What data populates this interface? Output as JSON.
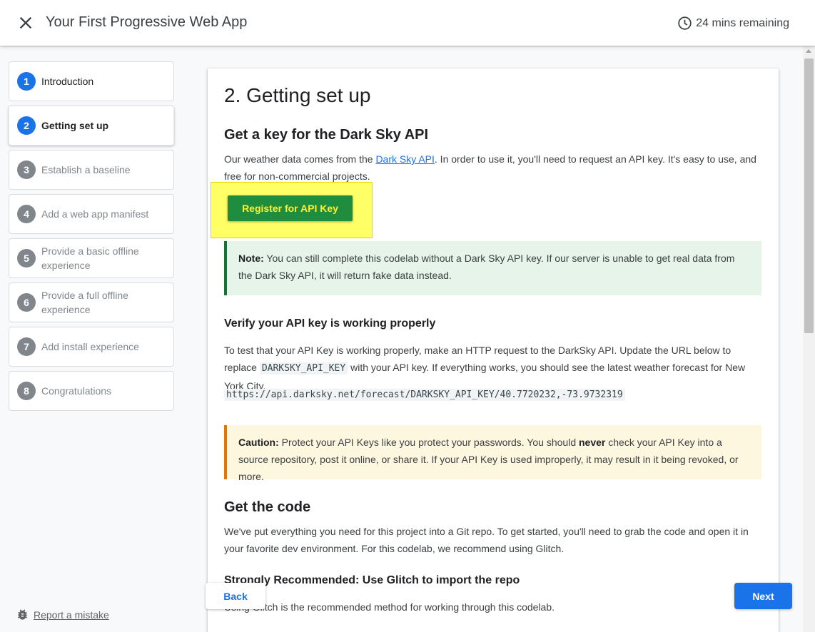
{
  "header": {
    "title": "Your First Progressive Web App",
    "time_remaining": "24 mins remaining"
  },
  "sidebar": {
    "steps": [
      {
        "number": "1",
        "label": "Introduction"
      },
      {
        "number": "2",
        "label": "Getting set up"
      },
      {
        "number": "3",
        "label": "Establish a baseline"
      },
      {
        "number": "4",
        "label": "Add a web app manifest"
      },
      {
        "number": "5",
        "label": "Provide a basic offline experience"
      },
      {
        "number": "6",
        "label": "Provide a full offline experience"
      },
      {
        "number": "7",
        "label": "Add install experience"
      },
      {
        "number": "8",
        "label": "Congratulations"
      }
    ],
    "report_label": "Report a mistake"
  },
  "content": {
    "title": "2. Getting set up",
    "section1": {
      "heading": "Get a key for the Dark Sky API",
      "para_before": "Our weather data comes from the ",
      "link": "Dark Sky API",
      "para_after": ". In order to use it, you'll need to request an API key. It's easy to use, and free for non-commercial projects.",
      "button": "Register for API Key"
    },
    "note": {
      "label": "Note:",
      "text": " You can still complete this codelab without a Dark Sky API key. If our server is unable to get real data from the Dark Sky API, it will return fake data instead."
    },
    "section2": {
      "heading": "Verify your API key is working properly",
      "para_before": "To test that your API Key is working properly, make an HTTP request to the DarkSky API. Update the URL below to replace ",
      "code": "DARKSKY_API_KEY",
      "para_after": " with your API key. If everything works, you should see the latest weather forecast for New York City.",
      "url": "https://api.darksky.net/forecast/DARKSKY_API_KEY/40.7720232,-73.9732319"
    },
    "caution": {
      "label": "Caution:",
      "text_before": " Protect your API Keys like you protect your passwords. You should ",
      "emphasis": "never",
      "text_after": " check your API Key into a source repository, post it online, or share it. If your API Key is used improperly, it may result in it being revoked, or more."
    },
    "section3": {
      "heading": "Get the code",
      "para": "We've put everything you need for this project into a Git repo. To get started, you'll need to grab the code and open it in your favorite dev environment. For this codelab, we recommend using Glitch."
    },
    "section4": {
      "heading": "Strongly Recommended: Use Glitch to import the repo",
      "para": "Using Glitch is the recommended method for working through this codelab."
    }
  },
  "nav": {
    "back": "Back",
    "next": "Next"
  },
  "colors": {
    "accent": "#1a73e8",
    "register_button_bg": "#1e8e3e",
    "register_button_text": "#ffee33",
    "highlight": "#ffff66",
    "note_bg": "#e6f4ea",
    "caution_bg": "#fef7e0"
  },
  "icons": {
    "close": "close-icon",
    "timer": "clock-icon",
    "report": "bug-icon"
  }
}
